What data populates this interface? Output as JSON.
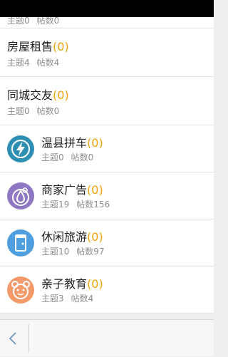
{
  "forums": [
    {
      "name": "",
      "count": "",
      "topics_label": "主题0",
      "posts_label": "帖数0",
      "icon": "none"
    },
    {
      "name": "房屋租售",
      "count": "(0)",
      "topics_label": "主题4",
      "posts_label": "帖数4",
      "icon": "none"
    },
    {
      "name": "同城交友",
      "count": "(0)",
      "topics_label": "主题0",
      "posts_label": "帖数0",
      "icon": "none"
    },
    {
      "name": "温县拼车",
      "count": "(0)",
      "topics_label": "主题0",
      "posts_label": "帖数0",
      "icon": "lightning-icon",
      "icon_color": "#2f8fb3"
    },
    {
      "name": "商家广告",
      "count": "(0)",
      "topics_label": "主题19",
      "posts_label": "帖数156",
      "icon": "droplet-icon",
      "icon_color": "#8f78c3"
    },
    {
      "name": "休闲旅游",
      "count": "(0)",
      "topics_label": "主题10",
      "posts_label": "帖数97",
      "icon": "door-icon",
      "icon_color": "#4f9fe0"
    },
    {
      "name": "亲子教育",
      "count": "(0)",
      "topics_label": "主题3",
      "posts_label": "帖数4",
      "icon": "bear-face-icon",
      "icon_color": "#f39a6b"
    }
  ],
  "colors": {
    "accent": "#f0a30a",
    "meta": "#8d8d8d",
    "divider": "#e3e3e3"
  },
  "bottom_bar": {
    "back_icon": "chevron-left-icon"
  }
}
